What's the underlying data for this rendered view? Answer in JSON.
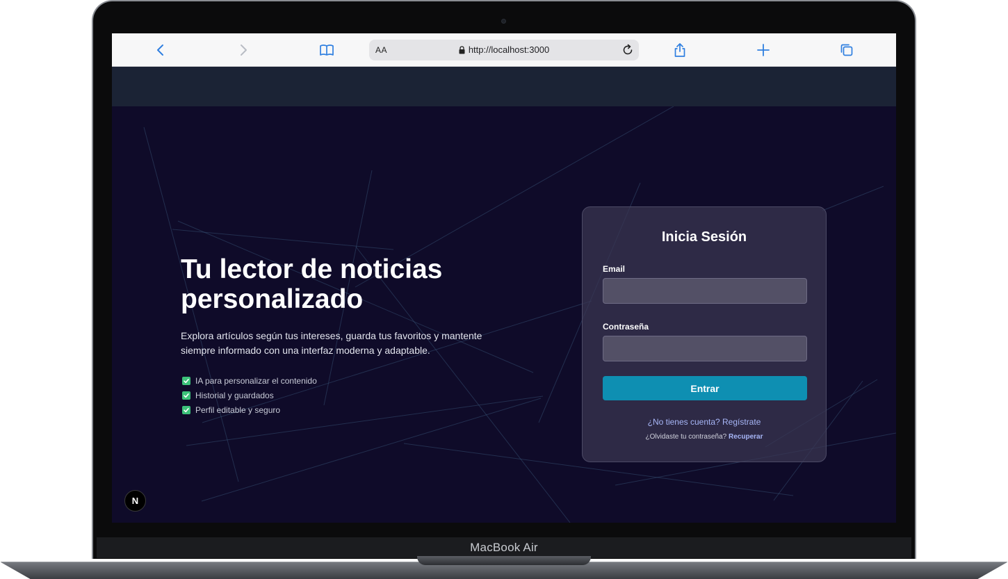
{
  "device": {
    "label": "MacBook Air"
  },
  "browser": {
    "text_size_label": "AA",
    "url": "http://localhost:3000"
  },
  "hero": {
    "title": "Tu lector de noticias personalizado",
    "description": "Explora artículos según tus intereses, guarda tus favoritos y mantente siempre informado con una interfaz moderna y adaptable.",
    "features": [
      "IA para personalizar el contenido",
      "Historial y guardados",
      "Perfil editable y seguro"
    ]
  },
  "login": {
    "title": "Inicia Sesión",
    "email_label": "Email",
    "email_value": "",
    "password_label": "Contraseña",
    "password_value": "",
    "submit_label": "Entrar",
    "register_text": "¿No tienes cuenta? Regístrate",
    "forgot_text": "¿Olvidaste tu contraseña?",
    "recover_link": "Recuperar"
  },
  "badge": {
    "letter": "N"
  },
  "colors": {
    "page_background": "#0f0b29",
    "header_band": "#1b2335",
    "accent_button": "#0e8fb2",
    "link": "#a7b6f7",
    "check": "#3cc27a"
  }
}
